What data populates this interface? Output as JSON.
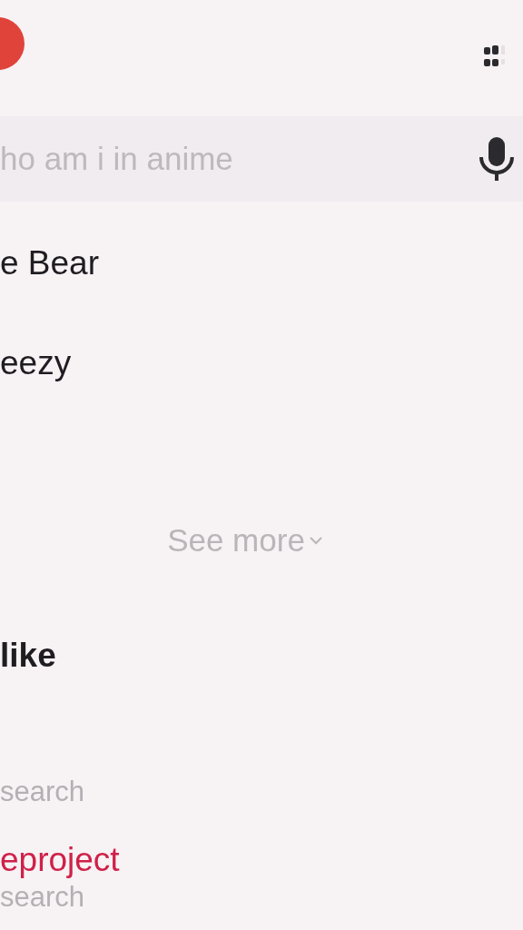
{
  "search": {
    "placeholder": "ho am i in anime"
  },
  "suggestions": [
    {
      "text": "e Bear"
    },
    {
      "text": "eezy"
    }
  ],
  "see_more": "See more",
  "section_title": "like",
  "results": [
    {
      "subtitle": "search"
    },
    {
      "title": "eproject",
      "subtitle": "search"
    }
  ]
}
